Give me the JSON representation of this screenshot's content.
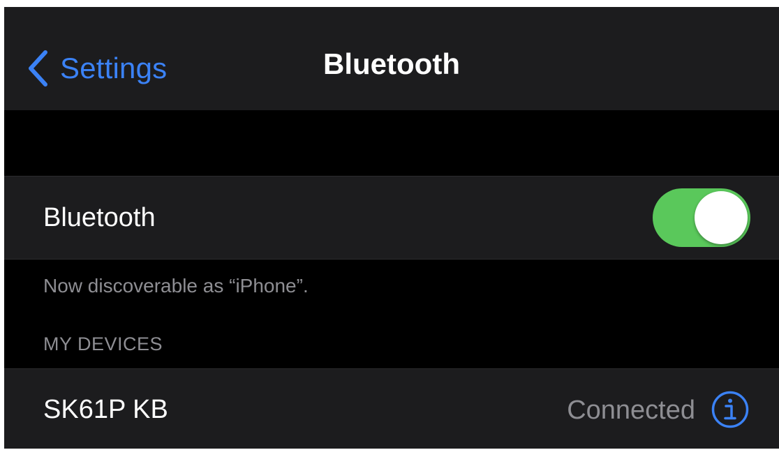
{
  "colors": {
    "accent": "#3b82f6",
    "toggle_on": "#5ac85b",
    "background": "#000000",
    "cell_background": "#1c1c1e",
    "secondary_text": "#8e8e93"
  },
  "nav": {
    "back_label": "Settings",
    "back_icon": "chevron-left-icon",
    "title": "Bluetooth"
  },
  "bluetooth_cell": {
    "label": "Bluetooth",
    "toggle_on": true
  },
  "discoverable_text": "Now discoverable as “iPhone”.",
  "my_devices": {
    "header": "MY DEVICES",
    "devices": [
      {
        "name": "SK61P KB",
        "status": "Connected",
        "info_icon": "info-circle-icon"
      }
    ]
  }
}
